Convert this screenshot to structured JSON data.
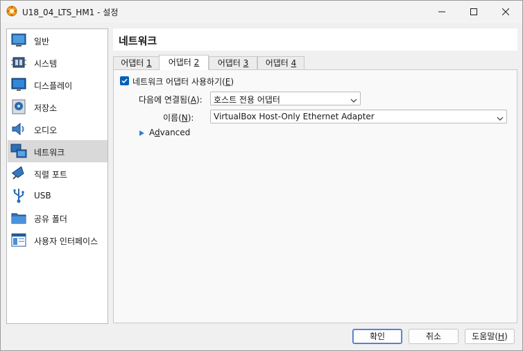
{
  "window": {
    "title": "U18_04_LTS_HM1 - 설정",
    "controls": [
      "minimize",
      "maximize",
      "close"
    ]
  },
  "sidebar": {
    "items": [
      {
        "label": "일반",
        "icon": "general-icon"
      },
      {
        "label": "시스템",
        "icon": "system-chip-icon"
      },
      {
        "label": "디스플레이",
        "icon": "display-monitor-icon"
      },
      {
        "label": "저장소",
        "icon": "storage-disk-icon"
      },
      {
        "label": "오디오",
        "icon": "audio-speaker-icon"
      },
      {
        "label": "네트워크",
        "icon": "network-icon",
        "selected": true
      },
      {
        "label": "직렬 포트",
        "icon": "serial-port-icon"
      },
      {
        "label": "USB",
        "icon": "usb-icon"
      },
      {
        "label": "공유 폴더",
        "icon": "shared-folder-icon"
      },
      {
        "label": "사용자 인터페이스",
        "icon": "user-interface-icon"
      }
    ]
  },
  "panel": {
    "title": "네트워크",
    "tabs": [
      {
        "label": "어댑터 1",
        "mnemonic": "1",
        "prefix": "어댑터 "
      },
      {
        "label": "어댑터 2",
        "mnemonic": "2",
        "prefix": "어댑터 ",
        "active": true
      },
      {
        "label": "어댑터 3",
        "mnemonic": "3",
        "prefix": "어댑터 "
      },
      {
        "label": "어댑터 4",
        "mnemonic": "4",
        "prefix": "어댑터 "
      }
    ],
    "enable_adapter": {
      "label_prefix": "네트워크 어댑터 사용하기(",
      "mnemonic": "E",
      "label_suffix": ")",
      "checked": true
    },
    "attached_to": {
      "label_prefix": "다음에 연결됨(",
      "mnemonic": "A",
      "label_suffix": "):",
      "value": "호스트 전용 어댑터"
    },
    "name": {
      "label_prefix": "이름(",
      "mnemonic": "N",
      "label_suffix": "):",
      "value": "VirtualBox Host-Only Ethernet Adapter"
    },
    "advanced": {
      "mnemonic": "d",
      "label_prefix": "A",
      "label_suffix": "vanced"
    }
  },
  "buttons": {
    "ok": "확인",
    "cancel": "취소",
    "help_prefix": "도움말(",
    "help_mnemonic": "H",
    "help_suffix": ")"
  },
  "colors": {
    "accent": "#005fb8",
    "selection": "#d9d9d9",
    "window_bg": "#f0f0f0"
  }
}
